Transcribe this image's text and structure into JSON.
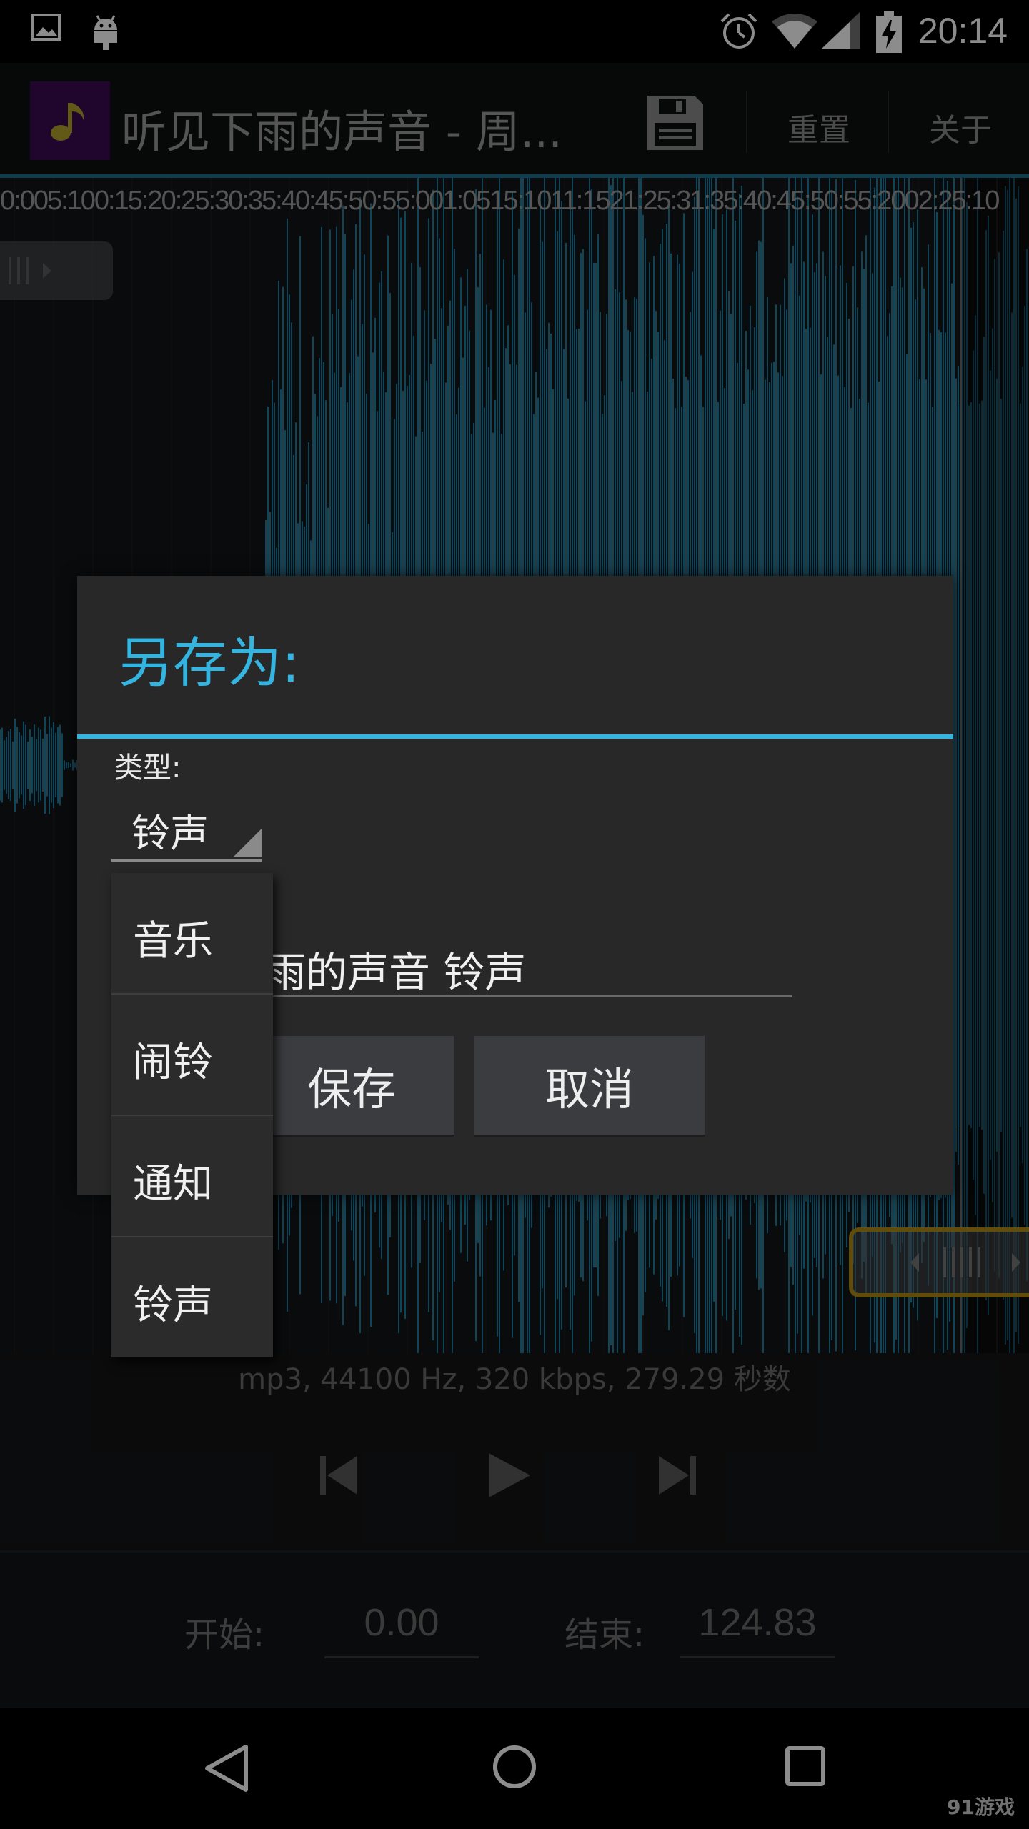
{
  "status_bar": {
    "time": "20:14",
    "icons": [
      "image-icon",
      "android-icon",
      "alarm-icon",
      "wifi-icon",
      "signal-icon",
      "battery-charging-icon"
    ]
  },
  "action_bar": {
    "title": "听见下雨的声音 - 周...",
    "save_icon": "save-icon",
    "reset_label": "重置",
    "about_label": "关于"
  },
  "timeline": {
    "ticks": [
      "0:00",
      "5",
      "0:10",
      "0:15",
      "0:20",
      "0:25",
      "0:30",
      "0:35",
      "0:40",
      "0:45",
      "0:50",
      "0:55",
      "1:00",
      "1:05",
      "1:10",
      "1:15",
      "1:20",
      "1:25",
      "1:30",
      "1:35",
      "1:40",
      "1:45",
      "1:50",
      "1:55",
      "2:00",
      "2:05",
      "2:10"
    ],
    "text": "0:005:100:15:20:25:30:35:40:45:50:55:001:0515:1011:1521:25:31:35:40:45:50:55:2002:25:10"
  },
  "dialog": {
    "title": "另存为:",
    "type_label": "类型:",
    "type_value": "铃声",
    "filename_value": "雨的声音 铃声",
    "save_label": "保存",
    "cancel_label": "取消"
  },
  "dropdown": {
    "options": [
      "音乐",
      "闹铃",
      "通知",
      "铃声"
    ]
  },
  "info": {
    "text": "mp3, 44100 Hz, 320 kbps, 279.29 秒数"
  },
  "range": {
    "start_label": "开始:",
    "start_value": "0.00",
    "end_label": "结束:",
    "end_value": "124.83"
  },
  "watermark": "91游戏",
  "colors": {
    "accent": "#35b4e0",
    "wave": "#1b8bb3",
    "handle": "#b08a14",
    "app_icon_bg": "#3b0c52",
    "note": "#b3a12a"
  }
}
